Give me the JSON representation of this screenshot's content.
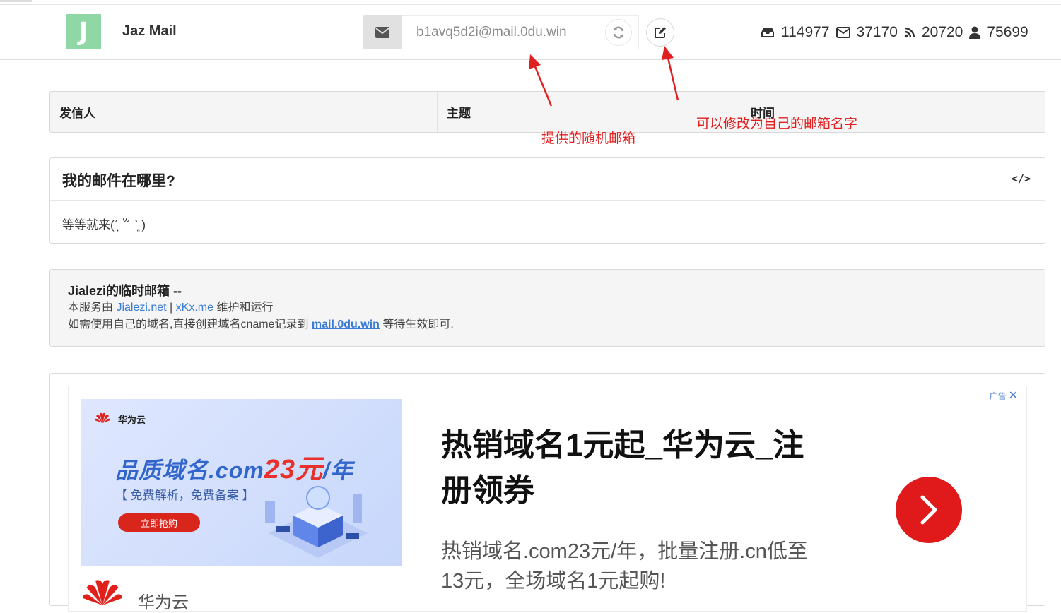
{
  "header": {
    "logo_letter": "J",
    "brand": "Jaz Mail",
    "email": "b1avq5d2i@mail.0du.win",
    "stats": [
      {
        "icon": "inbox-icon",
        "value": "114977"
      },
      {
        "icon": "envelope-icon",
        "value": "37170"
      },
      {
        "icon": "rss-icon",
        "value": "20720"
      },
      {
        "icon": "user-icon",
        "value": "75699"
      }
    ]
  },
  "inbox": {
    "columns": [
      "发信人",
      "主题",
      "时间"
    ]
  },
  "where": {
    "title": "我的邮件在哪里?",
    "code_icon": "</>",
    "body": "等等就来(ˊ͈ ꒳ ˋ͈ )"
  },
  "info": {
    "title": "Jialezi的临时邮箱 --",
    "line2_prefix": "本服务由 ",
    "link1": "Jialezi.net",
    "sep": " | ",
    "link2": "xKx.me",
    "line2_suffix": " 维护和运行",
    "line3_prefix": "如需使用自己的域名,直接创建域名cname记录到 ",
    "link3": "mail.0du.win",
    "line3_suffix": " 等待生效即可."
  },
  "ad": {
    "tag": "广告",
    "close": "✕",
    "img_brand": "华为云",
    "img_slogan_blue": "品质域名.com",
    "img_slogan_red": "23元",
    "img_slogan_tail": "/年",
    "img_sub": "【 免费解析，免费备案 】",
    "img_button": "立即抢购",
    "title": "热销域名1元起_华为云_注册领券",
    "desc": "热销域名.com23元/年，批量注册.cn低至13元，全场域名1元起购!",
    "brand_name": "华为云",
    "colors": {
      "red": "#e01a1a",
      "link": "#3a7bd5"
    }
  },
  "annotations": {
    "random_mail": "提供的随机邮箱",
    "edit_mail": "可以修改为自己的邮箱名字"
  }
}
